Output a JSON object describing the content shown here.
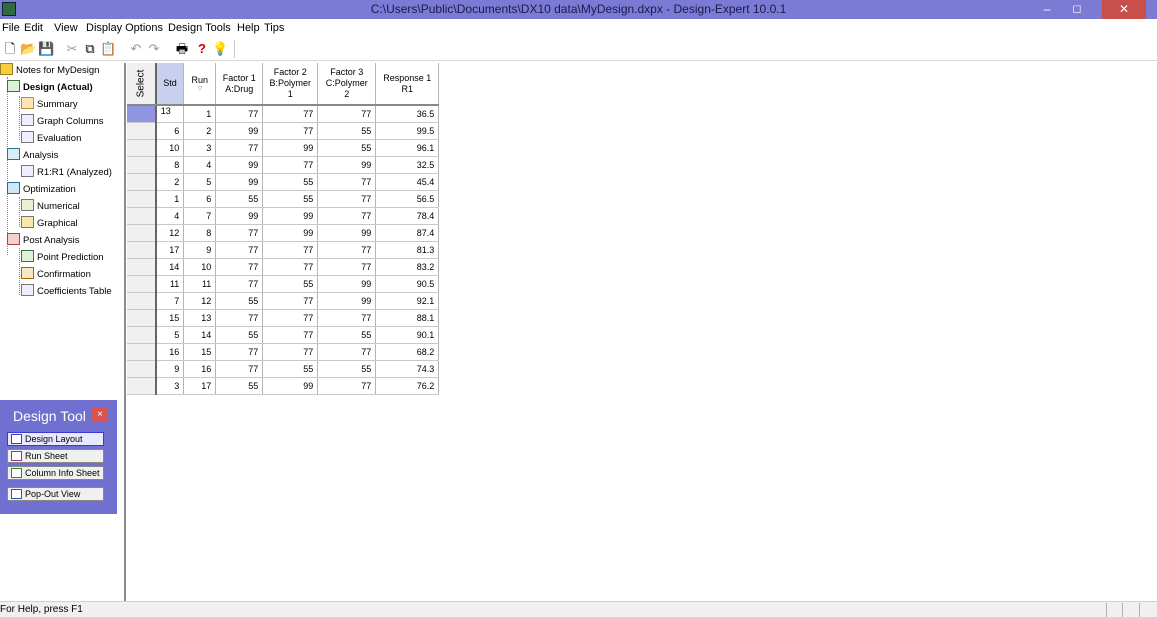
{
  "window": {
    "title": "C:\\Users\\Public\\Documents\\DX10 data\\MyDesign.dxpx - Design-Expert 10.0.1",
    "min_glyph": "–",
    "max_glyph": "◻",
    "close_glyph": "✕"
  },
  "menu": {
    "file": "File",
    "edit": "Edit",
    "view": "View",
    "display_options": "Display Options",
    "design_tools": "Design Tools",
    "help": "Help",
    "tips": "Tips"
  },
  "toolbar": {
    "new": "🗋",
    "open": "📂",
    "save": "💾",
    "cut": "✂",
    "copy": "⧉",
    "paste": "📋",
    "undo": "↶",
    "redo": "↷",
    "print": "🖶",
    "help": "?",
    "tips": "💡"
  },
  "tree": {
    "notes": "Notes for MyDesign",
    "design": "Design (Actual)",
    "summary": "Summary",
    "graph_columns": "Graph Columns",
    "evaluation": "Evaluation",
    "analysis": "Analysis",
    "r1": "R1:R1 (Analyzed)",
    "optimization": "Optimization",
    "numerical": "Numerical",
    "graphical": "Graphical",
    "post_analysis": "Post Analysis",
    "point_prediction": "Point Prediction",
    "confirmation": "Confirmation",
    "coefficients_table": "Coefficients Table"
  },
  "design_tool": {
    "title": "Design Tool",
    "close": "×",
    "design_layout": "Design Layout",
    "run_sheet": "Run Sheet",
    "column_info_sheet": "Column Info Sheet",
    "pop_out_view": "Pop-Out View"
  },
  "grid": {
    "select_label": "Select",
    "std_label": "Std",
    "run_label": "Run",
    "sort_glyph": "▽",
    "factor1_l1": "Factor 1",
    "factor1_l2": "A:Drug",
    "factor2_l1": "Factor 2",
    "factor2_l2": "B:Polymer 1",
    "factor3_l1": "Factor 3",
    "factor3_l2": "C:Polymer 2",
    "response1_l1": "Response 1",
    "response1_l2": "R1",
    "rows": [
      [
        "13",
        "1",
        "77",
        "77",
        "77",
        "36.5"
      ],
      [
        "6",
        "2",
        "99",
        "77",
        "55",
        "99.5"
      ],
      [
        "10",
        "3",
        "77",
        "99",
        "55",
        "96.1"
      ],
      [
        "8",
        "4",
        "99",
        "77",
        "99",
        "32.5"
      ],
      [
        "2",
        "5",
        "99",
        "55",
        "77",
        "45.4"
      ],
      [
        "1",
        "6",
        "55",
        "55",
        "77",
        "56.5"
      ],
      [
        "4",
        "7",
        "99",
        "99",
        "77",
        "78.4"
      ],
      [
        "12",
        "8",
        "77",
        "99",
        "99",
        "87.4"
      ],
      [
        "17",
        "9",
        "77",
        "77",
        "77",
        "81.3"
      ],
      [
        "14",
        "10",
        "77",
        "77",
        "77",
        "83.2"
      ],
      [
        "11",
        "11",
        "77",
        "55",
        "99",
        "90.5"
      ],
      [
        "7",
        "12",
        "55",
        "77",
        "99",
        "92.1"
      ],
      [
        "15",
        "13",
        "77",
        "77",
        "77",
        "88.1"
      ],
      [
        "5",
        "14",
        "55",
        "77",
        "55",
        "90.1"
      ],
      [
        "16",
        "15",
        "77",
        "77",
        "77",
        "68.2"
      ],
      [
        "9",
        "16",
        "77",
        "55",
        "55",
        "74.3"
      ],
      [
        "3",
        "17",
        "55",
        "99",
        "77",
        "76.2"
      ]
    ]
  },
  "status": {
    "text": "For Help, press F1"
  },
  "colors": {
    "title_bar": "#7b7bd6",
    "close_button": "#c7504b",
    "design_tool_panel": "#6f70cf",
    "selected_row_marker": "#8f95df"
  }
}
